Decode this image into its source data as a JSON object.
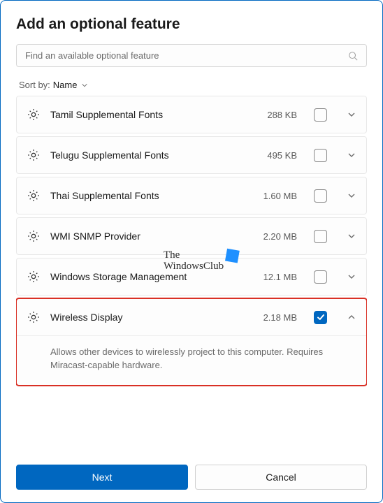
{
  "title": "Add an optional feature",
  "search": {
    "placeholder": "Find an available optional feature"
  },
  "sort": {
    "label": "Sort by:",
    "value": "Name"
  },
  "features": [
    {
      "name": "Tamil Supplemental Fonts",
      "size": "288 KB",
      "checked": false,
      "expanded": false
    },
    {
      "name": "Telugu Supplemental Fonts",
      "size": "495 KB",
      "checked": false,
      "expanded": false
    },
    {
      "name": "Thai Supplemental Fonts",
      "size": "1.60 MB",
      "checked": false,
      "expanded": false
    },
    {
      "name": "WMI SNMP Provider",
      "size": "2.20 MB",
      "checked": false,
      "expanded": false
    },
    {
      "name": "Windows Storage Management",
      "size": "12.1 MB",
      "checked": false,
      "expanded": false
    },
    {
      "name": "Wireless Display",
      "size": "2.18 MB",
      "checked": true,
      "expanded": true,
      "description": "Allows other devices to wirelessly project to this computer. Requires Miracast-capable hardware.",
      "highlight": true
    }
  ],
  "buttons": {
    "next": "Next",
    "cancel": "Cancel"
  },
  "watermark": {
    "line1": "The",
    "line2": "WindowsClub"
  }
}
